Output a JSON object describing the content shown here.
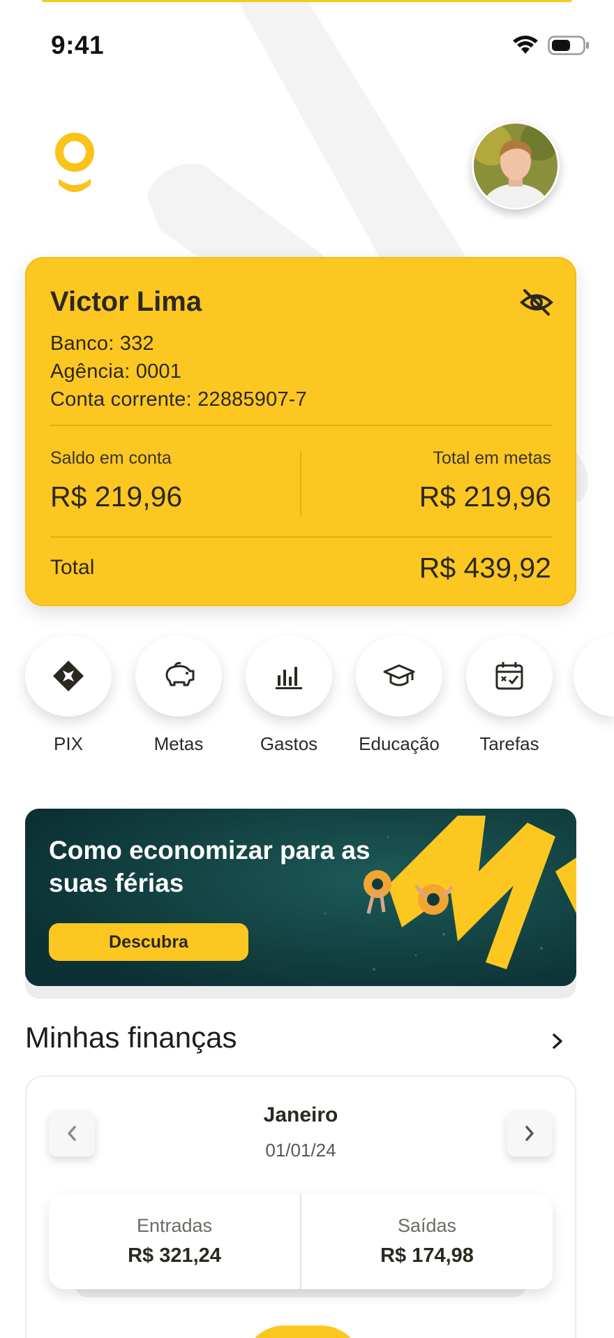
{
  "status_bar": {
    "time": "9:41",
    "icons": [
      "wifi-icon",
      "battery-icon"
    ]
  },
  "header": {
    "logo_icon": "logo-icon",
    "avatar_icon": "profile-avatar"
  },
  "account": {
    "holder_name": "Victor Lima",
    "bank_label": "Banco:",
    "bank_value": "332",
    "agency_label": "Agência:",
    "agency_value": "0001",
    "account_label": "Conta corrente:",
    "account_value": "22885907-7",
    "hide_icon": "eye-off-icon",
    "balance_label": "Saldo em conta",
    "balance_value": "R$ 219,96",
    "goals_label": "Total em metas",
    "goals_value": "R$ 219,96",
    "total_label": "Total",
    "total_value": "R$ 439,92"
  },
  "quick_actions": [
    {
      "label": "PIX",
      "icon": "pix-icon"
    },
    {
      "label": "Metas",
      "icon": "piggy-bank-icon"
    },
    {
      "label": "Gastos",
      "icon": "bar-chart-icon"
    },
    {
      "label": "Educação",
      "icon": "graduation-cap-icon"
    },
    {
      "label": "Tarefas",
      "icon": "calendar-check-icon"
    }
  ],
  "banner": {
    "title": "Como economizar para as suas férias",
    "button_label": "Descubra"
  },
  "finances": {
    "title": "Minhas finanças",
    "month": "Janeiro",
    "date": "01/01/24",
    "income_label": "Entradas",
    "income_value": "R$ 321,24",
    "expense_label": "Saídas",
    "expense_value": "R$ 174,98"
  },
  "colors": {
    "brand_yellow": "#fdc722",
    "text_dark": "#2b2822",
    "banner_teal": "#0f3b3e"
  }
}
